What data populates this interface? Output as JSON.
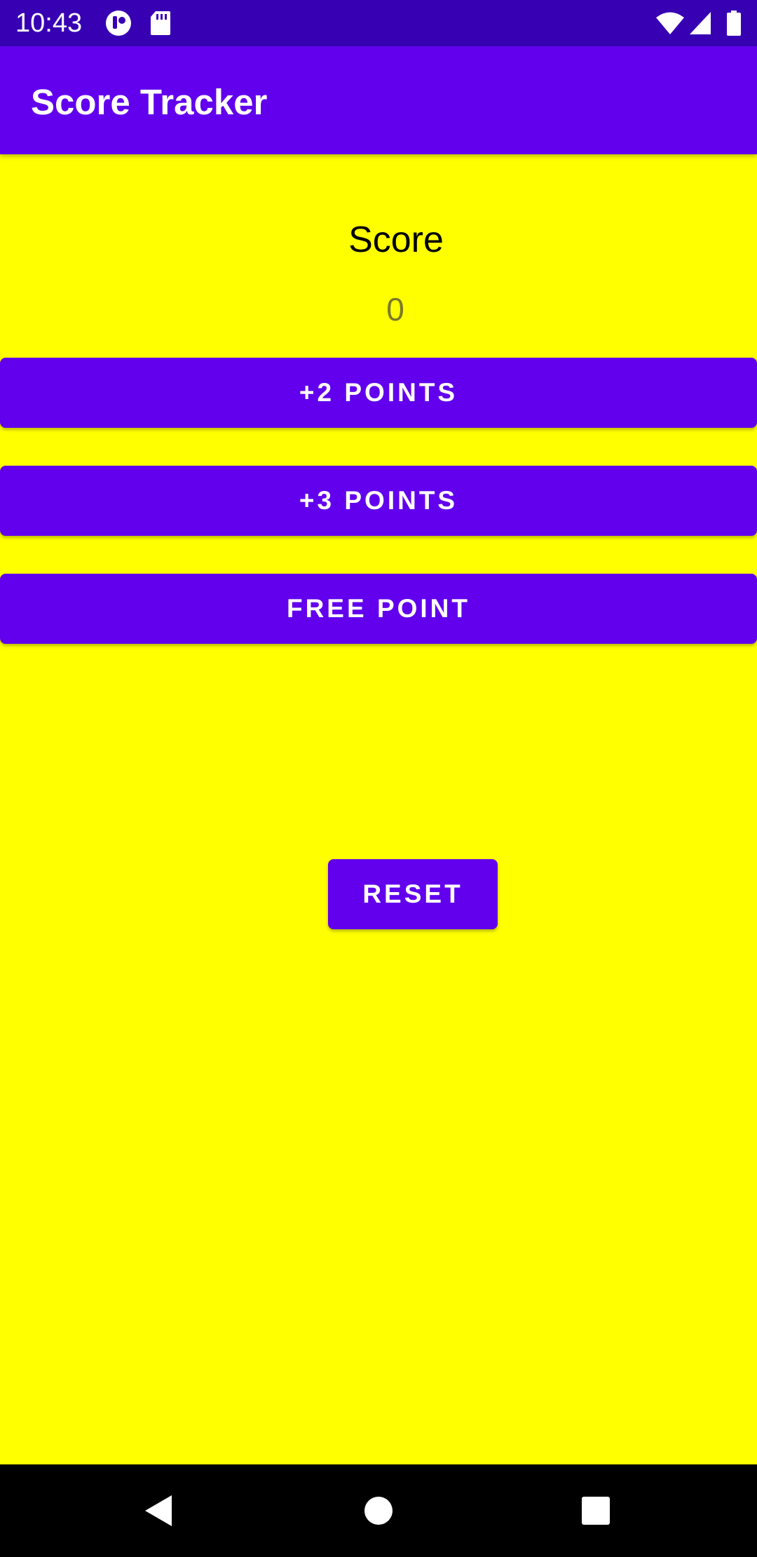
{
  "status_bar": {
    "time": "10:43",
    "icons": [
      "notification-app-icon",
      "sd-card-icon",
      "wifi-icon",
      "cell-signal-icon",
      "battery-icon"
    ]
  },
  "app_bar": {
    "title": "Score Tracker"
  },
  "main": {
    "score_label": "Score",
    "score_value": "0",
    "buttons": {
      "plus_two": "+2 POINTS",
      "plus_three": "+3 POINTS",
      "free_point": "FREE POINT",
      "reset": "RESET"
    }
  },
  "nav_bar": {
    "icons": [
      "back-icon",
      "home-icon",
      "recents-icon"
    ]
  },
  "colors": {
    "background": "#FFFF00",
    "primary": "#6200EE",
    "primary_dark": "#3700B3",
    "score_value": "#7a7a2a"
  }
}
